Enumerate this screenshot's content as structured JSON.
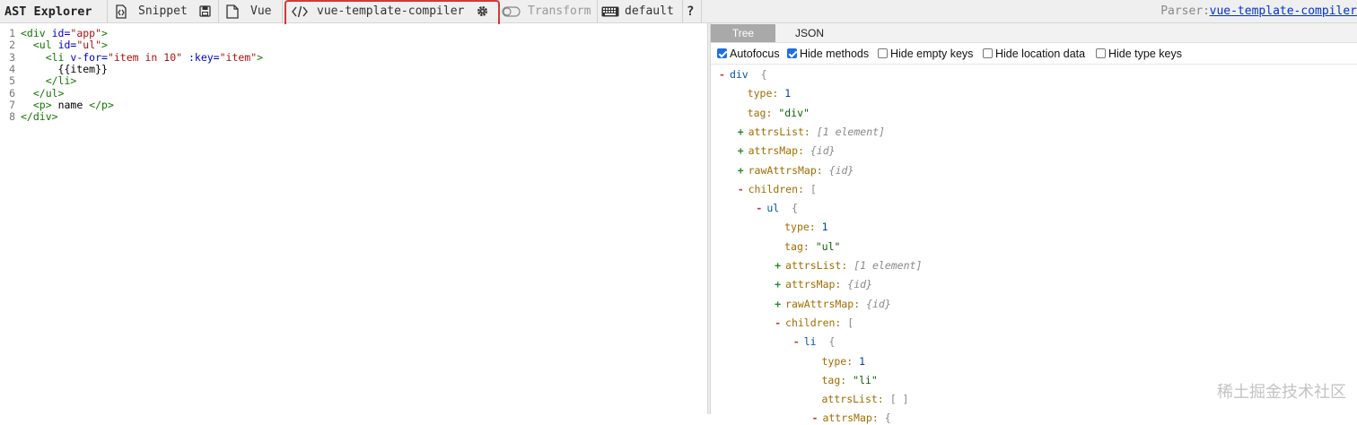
{
  "toolbar": {
    "app_title": "AST Explorer",
    "snippet_label": "Snippet",
    "language_label": "Vue",
    "parser_name": "vue-template-compiler",
    "transform_label": "Transform",
    "keymap_label": "default",
    "help_label": "?",
    "parser_prefix": "Parser:",
    "parser_link": "vue-template-compiler"
  },
  "editor": {
    "lines": [
      {
        "num": "1",
        "parts": [
          {
            "c": "t-tag",
            "t": "<div "
          },
          {
            "c": "t-attr",
            "t": "id="
          },
          {
            "c": "t-str",
            "t": "\"app\""
          },
          {
            "c": "t-tag",
            "t": ">"
          }
        ]
      },
      {
        "num": "2",
        "parts": [
          {
            "c": "t-txt",
            "t": "  "
          },
          {
            "c": "t-tag",
            "t": "<ul "
          },
          {
            "c": "t-attr",
            "t": "id="
          },
          {
            "c": "t-str",
            "t": "\"ul\""
          },
          {
            "c": "t-tag",
            "t": ">"
          }
        ]
      },
      {
        "num": "3",
        "parts": [
          {
            "c": "t-txt",
            "t": "    "
          },
          {
            "c": "t-tag",
            "t": "<li "
          },
          {
            "c": "t-attr",
            "t": "v-for="
          },
          {
            "c": "t-str",
            "t": "\"item in 10\" "
          },
          {
            "c": "t-attr",
            "t": ":key="
          },
          {
            "c": "t-str",
            "t": "\"item\""
          },
          {
            "c": "t-tag",
            "t": ">"
          }
        ]
      },
      {
        "num": "4",
        "parts": [
          {
            "c": "t-txt",
            "t": "      {{item}}"
          }
        ]
      },
      {
        "num": "5",
        "parts": [
          {
            "c": "t-txt",
            "t": "    "
          },
          {
            "c": "t-tag",
            "t": "</li>"
          }
        ]
      },
      {
        "num": "6",
        "parts": [
          {
            "c": "t-txt",
            "t": "  "
          },
          {
            "c": "t-tag",
            "t": "</ul>"
          }
        ]
      },
      {
        "num": "7",
        "parts": [
          {
            "c": "t-txt",
            "t": "  "
          },
          {
            "c": "t-tag",
            "t": "<p>"
          },
          {
            "c": "t-txt",
            "t": " name "
          },
          {
            "c": "t-tag",
            "t": "</p>"
          }
        ]
      },
      {
        "num": "8",
        "parts": [
          {
            "c": "t-tag",
            "t": "</div>"
          }
        ]
      }
    ]
  },
  "output": {
    "tabs": {
      "tree": "Tree",
      "json": "JSON"
    },
    "options": [
      {
        "label": "Autofocus",
        "checked": true
      },
      {
        "label": "Hide methods",
        "checked": true
      },
      {
        "label": "Hide empty keys",
        "checked": false
      },
      {
        "label": "Hide location data",
        "checked": false
      },
      {
        "label": "Hide type keys",
        "checked": false
      }
    ],
    "tree": [
      {
        "depth": 0,
        "toggle": "-",
        "key": "div",
        "key_class": "k-node",
        "value": "{",
        "value_class": "v-gray"
      },
      {
        "depth": 1,
        "toggle": "",
        "key": "type:",
        "key_class": "k-prop",
        "value": "1",
        "value_class": "v-num"
      },
      {
        "depth": 1,
        "toggle": "",
        "key": "tag:",
        "key_class": "k-prop",
        "value": "\"div\"",
        "value_class": "v-str"
      },
      {
        "depth": 1,
        "toggle": "+",
        "key": "attrsList:",
        "key_class": "k-prop",
        "value": "[1 element]",
        "value_class": "v-ital"
      },
      {
        "depth": 1,
        "toggle": "+",
        "key": "attrsMap:",
        "key_class": "k-prop",
        "value": "{id}",
        "value_class": "v-ital"
      },
      {
        "depth": 1,
        "toggle": "+",
        "key": "rawAttrsMap:",
        "key_class": "k-prop",
        "value": "{id}",
        "value_class": "v-ital"
      },
      {
        "depth": 1,
        "toggle": "-",
        "key": "children:",
        "key_class": "k-prop",
        "value": "[",
        "value_class": "v-gray"
      },
      {
        "depth": 2,
        "toggle": "-",
        "key": "ul",
        "key_class": "k-node",
        "value": "{",
        "value_class": "v-gray"
      },
      {
        "depth": 3,
        "toggle": "",
        "key": "type:",
        "key_class": "k-prop",
        "value": "1",
        "value_class": "v-num"
      },
      {
        "depth": 3,
        "toggle": "",
        "key": "tag:",
        "key_class": "k-prop",
        "value": "\"ul\"",
        "value_class": "v-str"
      },
      {
        "depth": 3,
        "toggle": "+",
        "key": "attrsList:",
        "key_class": "k-prop",
        "value": "[1 element]",
        "value_class": "v-ital"
      },
      {
        "depth": 3,
        "toggle": "+",
        "key": "attrsMap:",
        "key_class": "k-prop",
        "value": "{id}",
        "value_class": "v-ital"
      },
      {
        "depth": 3,
        "toggle": "+",
        "key": "rawAttrsMap:",
        "key_class": "k-prop",
        "value": "{id}",
        "value_class": "v-ital"
      },
      {
        "depth": 3,
        "toggle": "-",
        "key": "children:",
        "key_class": "k-prop",
        "value": "[",
        "value_class": "v-gray"
      },
      {
        "depth": 4,
        "toggle": "-",
        "key": "li",
        "key_class": "k-node",
        "value": "{",
        "value_class": "v-gray"
      },
      {
        "depth": 5,
        "toggle": "",
        "key": "type:",
        "key_class": "k-prop",
        "value": "1",
        "value_class": "v-num"
      },
      {
        "depth": 5,
        "toggle": "",
        "key": "tag:",
        "key_class": "k-prop",
        "value": "\"li\"",
        "value_class": "v-str"
      },
      {
        "depth": 5,
        "toggle": "",
        "key": "attrsList:",
        "key_class": "k-prop",
        "value": "[ ]",
        "value_class": "v-gray"
      },
      {
        "depth": 5,
        "toggle": "-",
        "key": "attrsMap:",
        "key_class": "k-prop",
        "value": "{",
        "value_class": "v-gray"
      }
    ]
  },
  "watermark": "稀土掘金技术社区"
}
